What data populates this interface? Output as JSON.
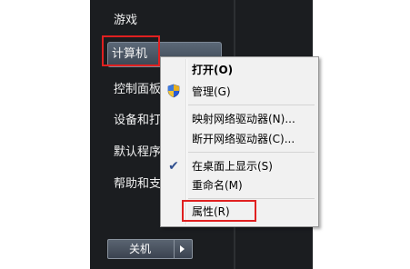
{
  "start_menu": {
    "items": [
      {
        "label": "游戏"
      },
      {
        "label": "计算机"
      },
      {
        "label": "控制面板"
      },
      {
        "label": "设备和打印"
      },
      {
        "label": "默认程序"
      },
      {
        "label": "帮助和支持"
      }
    ],
    "shutdown_label": "关机"
  },
  "context_menu": {
    "items": [
      {
        "label": "打开(O)"
      },
      {
        "label": "管理(G)"
      },
      {
        "label": "映射网络驱动器(N)..."
      },
      {
        "label": "断开网络驱动器(C)..."
      },
      {
        "label": "在桌面上显示(S)"
      },
      {
        "label": "重命名(M)"
      },
      {
        "label": "属性(R)"
      }
    ]
  },
  "colors": {
    "highlight_box": "#e02020",
    "start_menu_bg": "#1b1d20",
    "context_menu_bg": "#f1f1f1"
  },
  "icons": [
    "shield-icon",
    "checkmark-icon",
    "arrow-right-icon"
  ]
}
